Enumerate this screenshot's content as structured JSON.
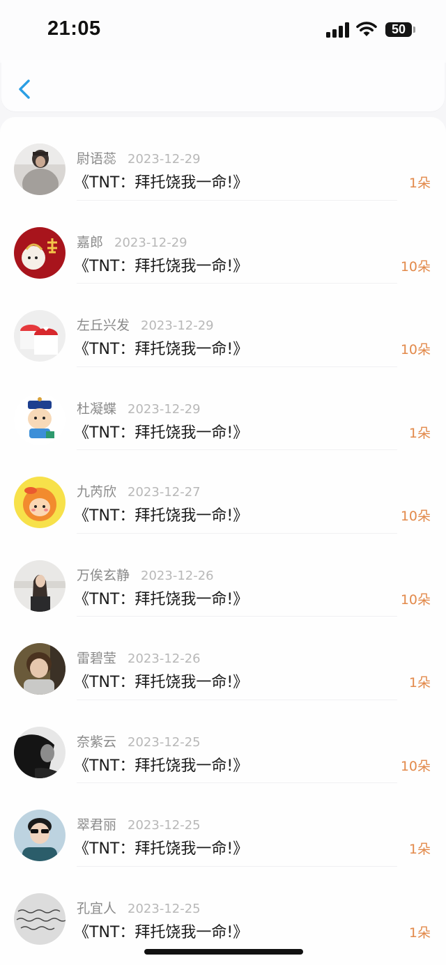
{
  "status_bar": {
    "time": "21:05",
    "battery": "50"
  },
  "nav": {
    "back_icon": "chevron-left-icon",
    "accent_color": "#2a9ee4"
  },
  "list": {
    "count_color": "#e2894a",
    "items": [
      {
        "name": "尉语蕊",
        "date": "2023-12-29",
        "title": "《TNT：拜托饶我一命!》",
        "count": "1朵",
        "avatar": "photo-fur-coat"
      },
      {
        "name": "嘉郎",
        "date": "2023-12-29",
        "title": "《TNT：拜托饶我一命!》",
        "count": "10朵",
        "avatar": "red-cartoon-朱"
      },
      {
        "name": "左丘兴发",
        "date": "2023-12-29",
        "title": "《TNT：拜托饶我一命!》",
        "count": "10朵",
        "avatar": "heart-cups"
      },
      {
        "name": "杜凝蝶",
        "date": "2023-12-29",
        "title": "《TNT：拜托饶我一命!》",
        "count": "1朵",
        "avatar": "cartoon-boy-hat"
      },
      {
        "name": "九芮欣",
        "date": "2023-12-27",
        "title": "《TNT：拜托饶我一命!》",
        "count": "10朵",
        "avatar": "yellow-cartoon-girl"
      },
      {
        "name": "万俟玄静",
        "date": "2023-12-26",
        "title": "《TNT：拜托饶我一命!》",
        "count": "10朵",
        "avatar": "photo-long-hair"
      },
      {
        "name": "雷碧莹",
        "date": "2023-12-26",
        "title": "《TNT：拜托饶我一命!》",
        "count": "1朵",
        "avatar": "photo-child"
      },
      {
        "name": "奈紫云",
        "date": "2023-12-25",
        "title": "《TNT：拜托饶我一命!》",
        "count": "10朵",
        "avatar": "photo-dark-profile"
      },
      {
        "name": "翠君丽",
        "date": "2023-12-25",
        "title": "《TNT：拜托饶我一命!》",
        "count": "1朵",
        "avatar": "photo-sunglasses"
      },
      {
        "name": "孔宜人",
        "date": "2023-12-25",
        "title": "《TNT：拜托饶我一命!》",
        "count": "1朵",
        "avatar": "handwriting"
      }
    ]
  }
}
